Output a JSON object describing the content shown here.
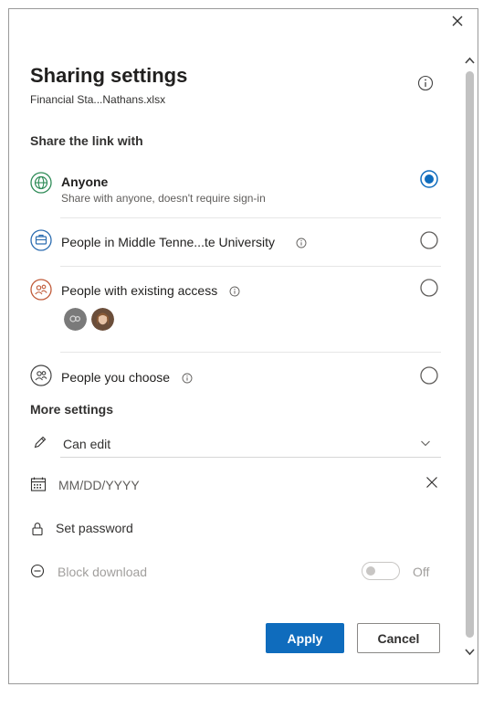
{
  "dialog": {
    "title": "Sharing settings",
    "filename": "Financial Sta...Nathans.xlsx"
  },
  "share_section": {
    "heading": "Share the link with",
    "options": [
      {
        "label": "Anyone",
        "description": "Share with anyone, doesn't require sign-in",
        "selected": true,
        "icon": "globe-icon"
      },
      {
        "label": "People in Middle Tenne...te University",
        "selected": false,
        "icon": "building-icon"
      },
      {
        "label": "People with existing access",
        "selected": false,
        "icon": "people-group-icon"
      },
      {
        "label": "People you choose",
        "selected": false,
        "icon": "people-choose-icon"
      }
    ]
  },
  "more_settings": {
    "heading": "More settings",
    "permission": "Can edit",
    "date_placeholder": "MM/DD/YYYY",
    "password_label": "Set password",
    "block_download_label": "Block download",
    "block_download_state": "Off"
  },
  "buttons": {
    "apply": "Apply",
    "cancel": "Cancel"
  },
  "colors": {
    "accent": "#0f6cbd",
    "scrollbar": "#c2c2c2",
    "globe_icon": "#2e8b57",
    "building_icon": "#2b6cb0",
    "people_icon": "#c05a38"
  }
}
